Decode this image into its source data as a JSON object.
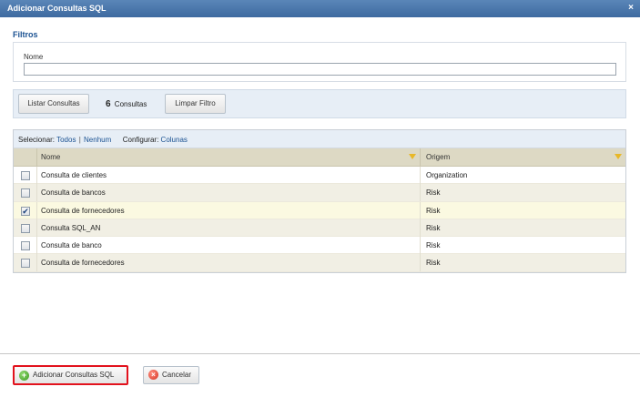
{
  "dialog": {
    "title": "Adicionar Consultas SQL",
    "close_glyph": "×"
  },
  "filters": {
    "section_label": "Filtros",
    "nome_label": "Nome",
    "nome_value": "",
    "nome_placeholder": ""
  },
  "actions": {
    "list_button": "Listar Consultas",
    "count": "6",
    "count_suffix": "Consultas",
    "clear_button": "Limpar Filtro"
  },
  "grid": {
    "toolbar": {
      "select_label": "Selecionar:",
      "all": "Todos",
      "separator": "|",
      "none": "Nenhum",
      "configure_label": "Configurar:",
      "columns": "Colunas"
    },
    "columns": [
      "Nome",
      "Origem"
    ],
    "rows": [
      {
        "nome": "Consulta de clientes",
        "origem": "Organization",
        "checked": false
      },
      {
        "nome": "Consulta de bancos",
        "origem": "Risk",
        "checked": false
      },
      {
        "nome": "Consulta de fornecedores",
        "origem": "Risk",
        "checked": true
      },
      {
        "nome": "Consulta SQL_AN",
        "origem": "Risk",
        "checked": false
      },
      {
        "nome": "Consulta de banco",
        "origem": "Risk",
        "checked": false
      },
      {
        "nome": "Consulta de fornecedores",
        "origem": "Risk",
        "checked": false
      }
    ]
  },
  "footer": {
    "add_button": "Adicionar Consultas SQL",
    "cancel_button": "Cancelar",
    "add_icon_glyph": "+",
    "cancel_icon_glyph": "×"
  },
  "colors": {
    "titlebar": "#4a76ab",
    "accent_link": "#1b5292",
    "header_bg": "#ddd9c4",
    "alt_row": "#f1efe4",
    "selected_row": "#fbf9e1",
    "highlight_border": "#e2121d"
  },
  "icons": {
    "close": "close-icon",
    "filter": "filter-funnel-icon",
    "add": "add-circle-icon",
    "cancel": "cancel-circle-icon"
  }
}
